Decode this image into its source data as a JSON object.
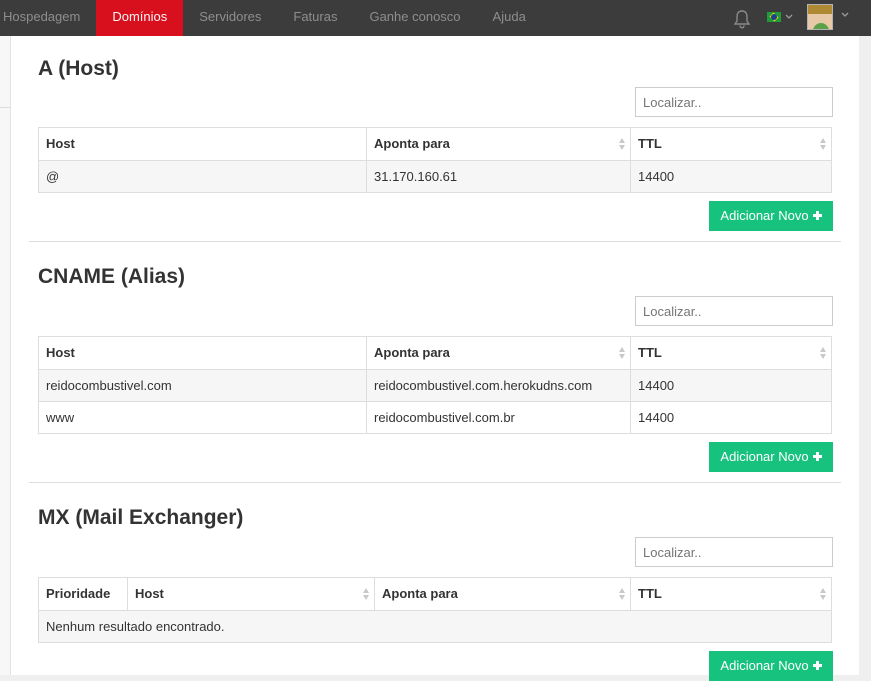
{
  "nav": {
    "items": [
      {
        "label": "Hospedagem",
        "active": false
      },
      {
        "label": "Domínios",
        "active": true
      },
      {
        "label": "Servidores",
        "active": false
      },
      {
        "label": "Faturas",
        "active": false
      },
      {
        "label": "Ganhe conosco",
        "active": false
      },
      {
        "label": "Ajuda",
        "active": false
      }
    ],
    "icons": [
      "bell-icon",
      "brazil-flag-icon",
      "chevron-down-icon",
      "avatar"
    ]
  },
  "colors": {
    "accent": "#d8101e",
    "topbar": "#3c3c3c",
    "button": "#17c27e"
  },
  "sections": {
    "a": {
      "title": "A (Host)",
      "search_placeholder": "Localizar..",
      "columns": [
        "Host",
        "Aponta para",
        "TTL"
      ],
      "rows": [
        [
          "@",
          "31.170.160.61",
          "14400"
        ]
      ],
      "add_label": "Adicionar Novo"
    },
    "cname": {
      "title": "CNAME (Alias)",
      "search_placeholder": "Localizar..",
      "columns": [
        "Host",
        "Aponta para",
        "TTL"
      ],
      "rows": [
        [
          "reidocombustivel.com",
          "reidocombustivel.com.herokudns.com",
          "14400"
        ],
        [
          "www",
          "reidocombustivel.com.br",
          "14400"
        ]
      ],
      "add_label": "Adicionar Novo"
    },
    "mx": {
      "title": "MX (Mail Exchanger)",
      "search_placeholder": "Localizar..",
      "columns": [
        "Prioridade",
        "Host",
        "Aponta para",
        "TTL"
      ],
      "empty_text": "Nenhum resultado encontrado.",
      "add_label": "Adicionar Novo"
    }
  }
}
